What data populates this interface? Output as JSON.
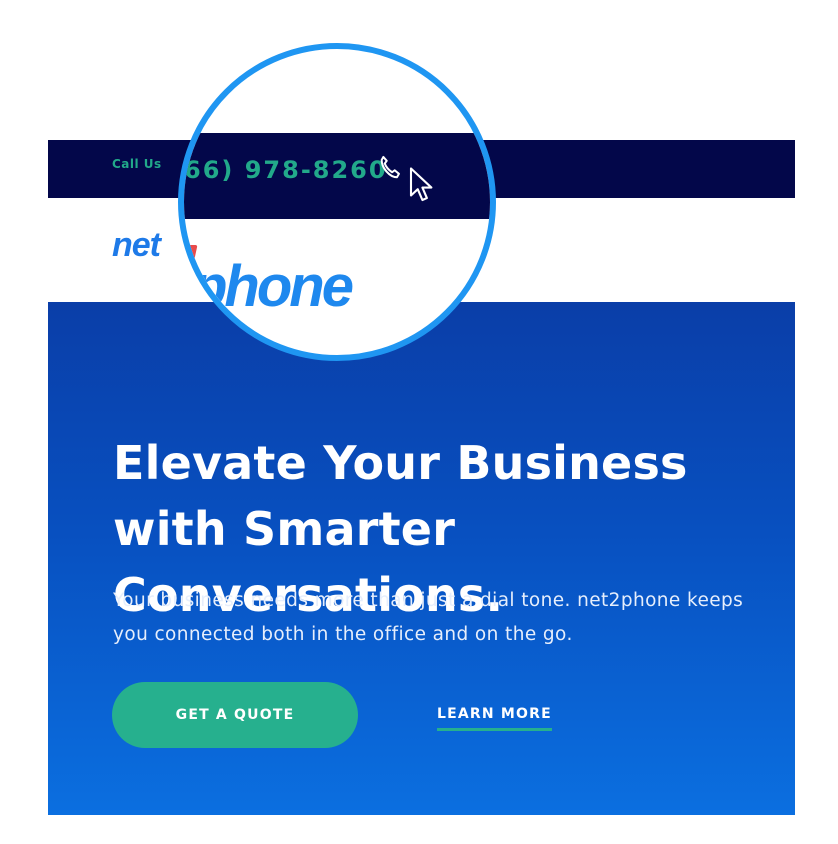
{
  "topbar": {
    "call_text": "Call Us (866) 978-8260",
    "magnified_phone": "66) 978-8260"
  },
  "header": {
    "logo_partial": "net",
    "magnified_logo": "phone"
  },
  "hero": {
    "title": "Elevate Your Business with Smarter Conversations.",
    "subtitle": "Your business needs more than just a dial tone. net2phone keeps you connected both in the office and on the go.",
    "primary_button": "GET A QUOTE",
    "secondary_link": "LEARN MORE"
  },
  "colors": {
    "navy": "#03074a",
    "accent_green": "#26b08e",
    "brand_blue": "#1e88ee",
    "magnifier_ring": "#1f96f2"
  },
  "icons": {
    "phone": "phone-icon",
    "cursor": "mouse-cursor-icon"
  }
}
